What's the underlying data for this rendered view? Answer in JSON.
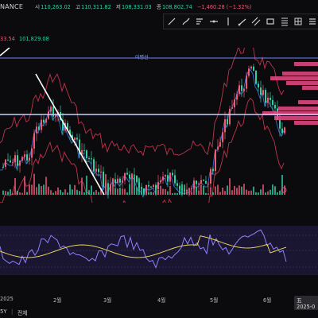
{
  "header": {
    "exchange": "NANCE",
    "ohlc": {
      "open_label": "시",
      "open": "110,263.02",
      "high_label": "고",
      "high": "110,311.82",
      "low_label": "저",
      "low": "108,331.03",
      "close_label": "종",
      "close": "108,802.74",
      "change": "−1,460.28 (−1.32%)"
    }
  },
  "left_values": {
    "a": "33.54",
    "b": "101,829.08"
  },
  "toolbar": {
    "tools": [
      "line-tool-icon",
      "brush-icon",
      "sort-lines-icon",
      "horizontal-line-icon",
      "vertical-line-icon",
      "ray-icon",
      "parallel-channel-icon",
      "rectangle-icon",
      "fib-icon",
      "grid-icon",
      "menu-icon"
    ]
  },
  "main": {
    "ma_label": "이평선",
    "colors": {
      "up": "#ef5a78",
      "down": "#2fd1a6",
      "vp": "#e84a86",
      "band": "#c1334e",
      "hline": "#8aa0ff"
    }
  },
  "xaxis": {
    "labels": [
      "2025",
      "2월",
      "3월",
      "4월",
      "5월",
      "6월"
    ],
    "cursor_date": "五 2025-0"
  },
  "bottombar": {
    "left": "5Y",
    "right": "전체"
  }
}
